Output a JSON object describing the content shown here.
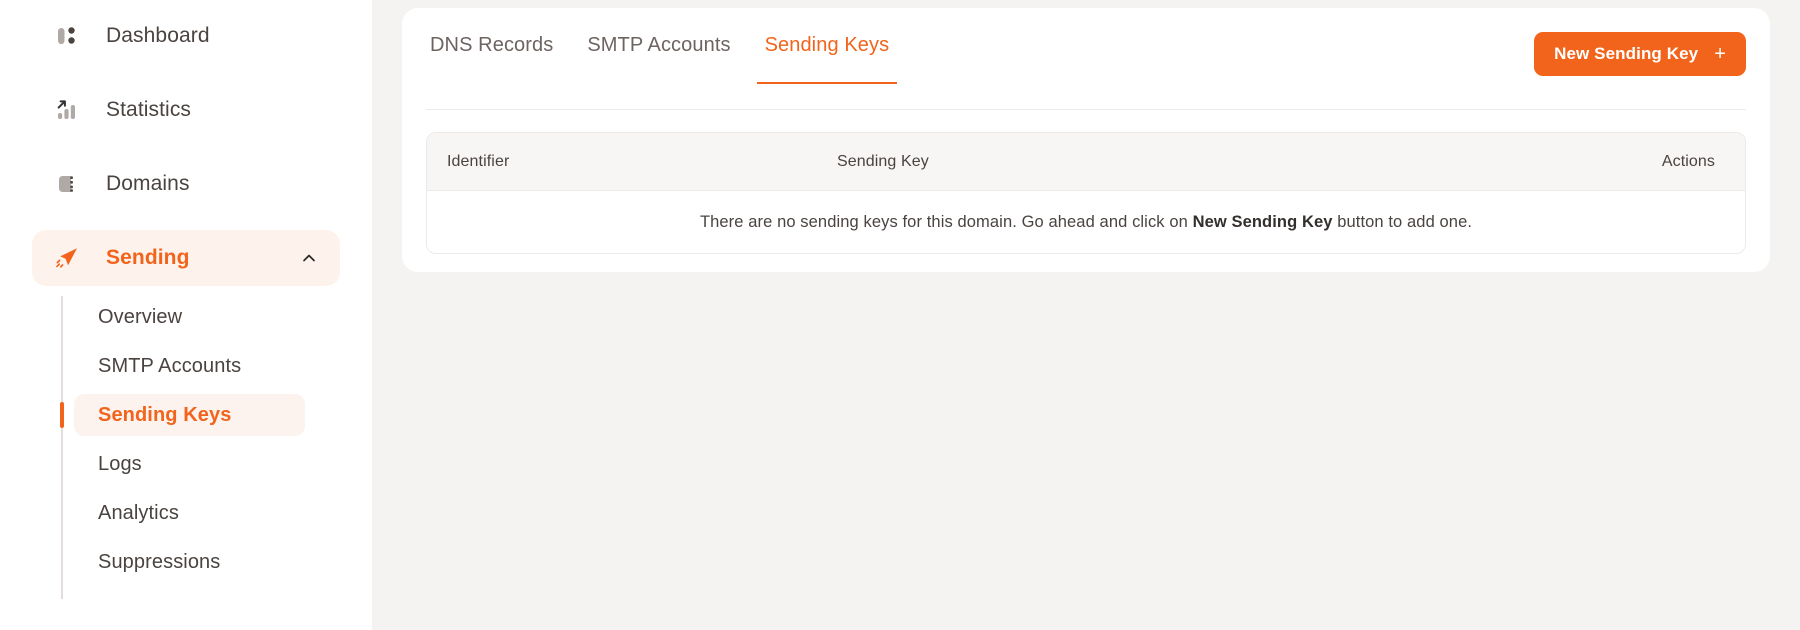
{
  "sidebar": {
    "items": [
      {
        "label": "Dashboard",
        "icon": "dashboard-icon",
        "active": false,
        "key": "dashboard"
      },
      {
        "label": "Statistics",
        "icon": "statistics-icon",
        "active": false,
        "key": "statistics"
      },
      {
        "label": "Domains",
        "icon": "domains-icon",
        "active": false,
        "key": "domains"
      },
      {
        "label": "Sending",
        "icon": "paper-plane-icon",
        "active": true,
        "key": "sending",
        "chevron": "chevron-up-icon"
      }
    ],
    "subitems": [
      {
        "label": "Overview",
        "active": false,
        "key": "overview"
      },
      {
        "label": "SMTP Accounts",
        "active": false,
        "key": "smtp-accounts"
      },
      {
        "label": "Sending Keys",
        "active": true,
        "key": "sending-keys"
      },
      {
        "label": "Logs",
        "active": false,
        "key": "logs"
      },
      {
        "label": "Analytics",
        "active": false,
        "key": "analytics"
      },
      {
        "label": "Suppressions",
        "active": false,
        "key": "suppressions"
      }
    ]
  },
  "main": {
    "tabs": [
      {
        "label": "DNS Records",
        "active": false,
        "key": "dns-records"
      },
      {
        "label": "SMTP Accounts",
        "active": false,
        "key": "smtp-accounts"
      },
      {
        "label": "Sending Keys",
        "active": true,
        "key": "sending-keys"
      }
    ],
    "new_key_button": {
      "label": "New Sending Key",
      "icon": "plus-icon"
    },
    "table": {
      "columns": [
        "Identifier",
        "Sending Key",
        "Actions"
      ],
      "rows": [],
      "empty_message_prefix": "There are no sending keys for this domain. Go ahead and click on ",
      "empty_message_bold": "New Sending Key",
      "empty_message_suffix": " button to add one."
    }
  },
  "colors": {
    "accent": "#f2641c",
    "accent_soft": "#fdf2ec",
    "text": "#4a4340",
    "text_muted": "#6d6461",
    "page_bg": "#f4f3f1",
    "card_bg": "#ffffff",
    "border": "#eceae8",
    "table_head_bg": "#f7f6f4"
  }
}
